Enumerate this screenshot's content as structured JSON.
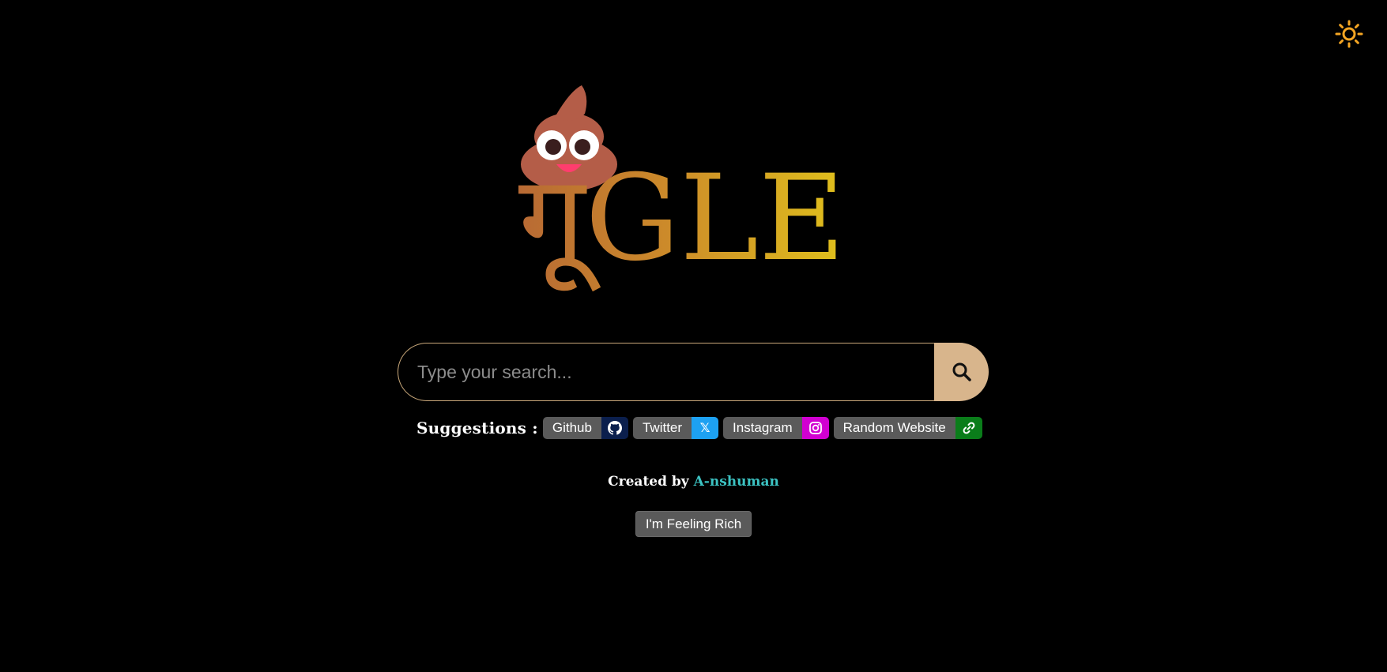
{
  "theme_toggle": {
    "icon": "sun-icon",
    "color": "#f5a623"
  },
  "logo": {
    "text": "गूGLE",
    "icon": "poop-emoji-icon"
  },
  "search": {
    "placeholder": "Type your search...",
    "value": "",
    "button_icon": "search-icon",
    "border_color": "#c9a87a",
    "button_color": "#d8b58c"
  },
  "suggestions": {
    "label": "Suggestions :",
    "items": [
      {
        "label": "Github",
        "icon": "github-icon",
        "icon_bg": "#0b1f4d"
      },
      {
        "label": "Twitter",
        "icon": "x-icon",
        "icon_text": "𝕏",
        "icon_bg": "#1da1f2"
      },
      {
        "label": "Instagram",
        "icon": "instagram-icon",
        "icon_bg": "#d100d1"
      },
      {
        "label": "Random Website",
        "icon": "link-icon",
        "icon_bg": "#0a7d1a"
      }
    ]
  },
  "credit": {
    "prefix": "Created by ",
    "author": "A-nshuman",
    "author_color": "#3cc3c3"
  },
  "feeling_rich_label": "I'm Feeling Rich"
}
